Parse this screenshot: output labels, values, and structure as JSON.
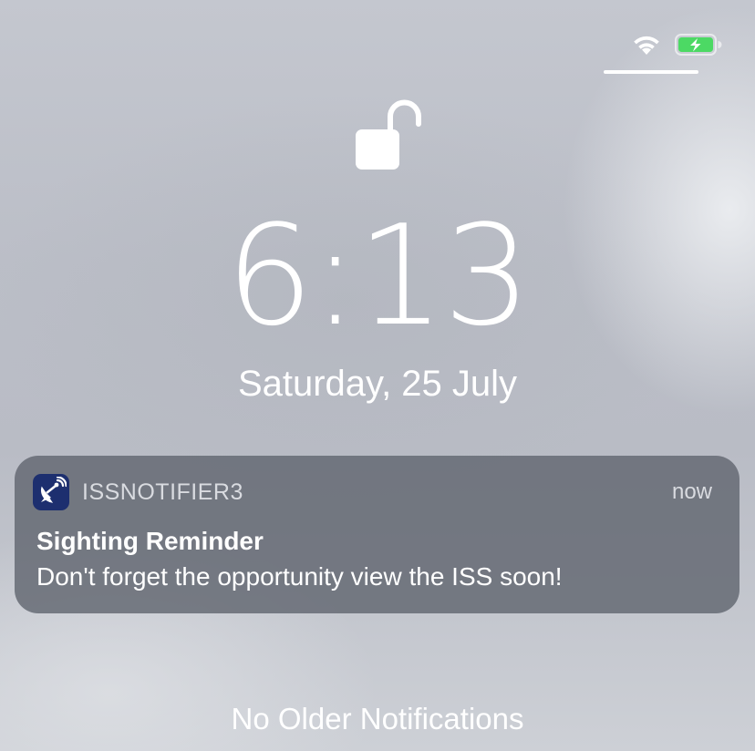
{
  "status_bar": {
    "wifi_icon": "wifi-icon",
    "battery_icon": "battery-charging-icon",
    "battery_color": "#4cd964"
  },
  "lock_screen": {
    "lock_icon": "unlocked-padlock-icon",
    "time": "6:13",
    "date": "Saturday, 25 July"
  },
  "notification": {
    "app_icon": "satellite-dish-icon",
    "app_icon_color": "#1d2f6f",
    "app_name": "ISSNOTIFIER3",
    "time": "now",
    "title": "Sighting Reminder",
    "body": "Don't forget the opportunity view the ISS soon!"
  },
  "footer": {
    "no_older_label": "No Older Notifications"
  }
}
